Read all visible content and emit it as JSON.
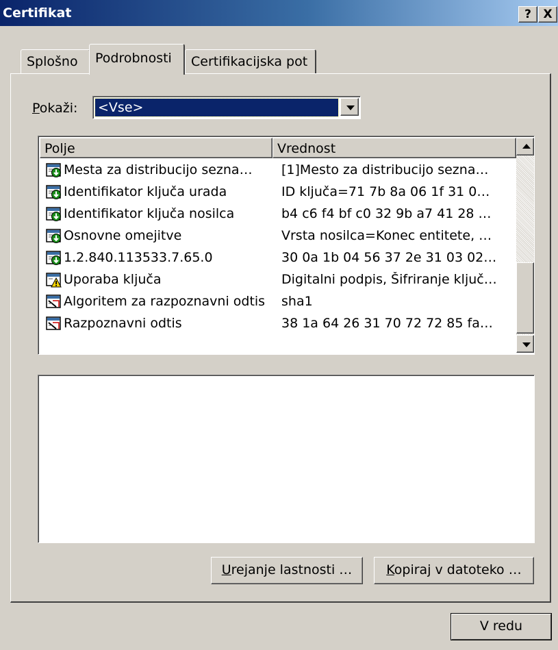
{
  "window": {
    "title": "Certifikat",
    "help_button": "?",
    "close_button": "X",
    "colors": {
      "titlebar_start": "#0a246a",
      "titlebar_end": "#a6caf0",
      "face": "#d4d0c8",
      "selection": "#0a246a"
    }
  },
  "tabs": [
    {
      "label": "Splošno",
      "active": false
    },
    {
      "label": "Podrobnosti",
      "active": true
    },
    {
      "label": "Certifikacijska pot",
      "active": false
    }
  ],
  "show_filter": {
    "label_prefix": "P",
    "label_rest": "okaži:",
    "selected_value": "<Vse>"
  },
  "list": {
    "columns": [
      "Polje",
      "Vrednost"
    ],
    "rows": [
      {
        "icon": "extension-icon",
        "field": "Mesta za distribucijo sezna…",
        "value": "[1]Mesto za distribucijo sezna…"
      },
      {
        "icon": "extension-icon",
        "field": "Identifikator ključa urada",
        "value": "ID ključa=71 7b 8a 06 1f 31 0…"
      },
      {
        "icon": "extension-icon",
        "field": "Identifikator ključa nosilca",
        "value": "b4 c6 f4 bf c0 32 9b a7 41 28 …"
      },
      {
        "icon": "extension-icon",
        "field": "Osnovne omejitve",
        "value": "Vrsta nosilca=Konec entitete, …"
      },
      {
        "icon": "extension-icon",
        "field": "1.2.840.113533.7.65.0",
        "value": "30 0a 1b 04 56 37 2e 31 03 02…"
      },
      {
        "icon": "warning-extension-icon",
        "field": "Uporaba ključa",
        "value": "Digitalni podpis, Šifriranje ključ…"
      },
      {
        "icon": "property-icon",
        "field": "Algoritem za razpoznavni odtis",
        "value": "sha1"
      },
      {
        "icon": "property-icon",
        "field": "Razpoznavni odtis",
        "value": "38 1a 64 26 31 70 72 72 85 fa…"
      }
    ]
  },
  "detail_text": "",
  "buttons": {
    "edit_properties_u": "U",
    "edit_properties_rest": "rejanje lastnosti …",
    "copy_to_file_u": "K",
    "copy_to_file_rest": "opiraj v datoteko …",
    "ok": "V redu"
  }
}
